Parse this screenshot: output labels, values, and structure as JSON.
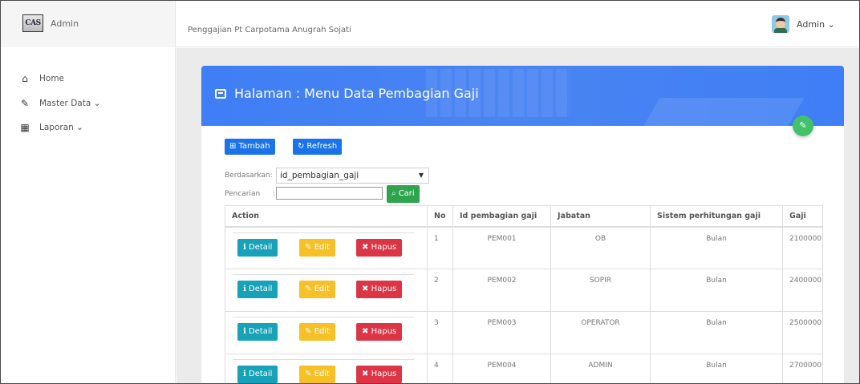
{
  "brand": {
    "logo_text": "CAS",
    "title": "Admin"
  },
  "header": {
    "app_title": "Penggajian Pt Carpotama Anugrah Sojati",
    "user_label": "Admin ⌄"
  },
  "sidebar": {
    "items": [
      {
        "label": "Home",
        "icon": "home-icon"
      },
      {
        "label": "Master Data ⌄",
        "icon": "edit-icon"
      },
      {
        "label": "Laporan ⌄",
        "icon": "calendar-icon"
      }
    ]
  },
  "page": {
    "title": "Halaman : Menu Data Pembagian Gaji",
    "add_label": "Tambah",
    "refresh_label": "Refresh",
    "filter_label": "Berdasarkan:",
    "filter_value": "id_pembagian_gaji",
    "search_label": "Pencarian",
    "search_sep": ":",
    "search_value": "",
    "search_button": "Cari"
  },
  "table": {
    "headers": [
      "Action",
      "No",
      "Id pembagian gaji",
      "Jabatan",
      "Sistem perhitungan gaji",
      "Gaji"
    ],
    "action_labels": {
      "detail": "Detail",
      "edit": "Edit",
      "delete": "Hapus"
    },
    "rows": [
      {
        "no": "1",
        "id": "PEM001",
        "jabatan": "OB",
        "sistem": "Bulan",
        "gaji": "2100000"
      },
      {
        "no": "2",
        "id": "PEM002",
        "jabatan": "SOPIR",
        "sistem": "Bulan",
        "gaji": "2400000"
      },
      {
        "no": "3",
        "id": "PEM003",
        "jabatan": "OPERATOR",
        "sistem": "Bulan",
        "gaji": "2500000"
      },
      {
        "no": "4",
        "id": "PEM004",
        "jabatan": "ADMIN",
        "sistem": "Bulan",
        "gaji": "2700000"
      }
    ]
  },
  "colors": {
    "primary": "#3f7ef5",
    "success": "#2ea44f",
    "info": "#17a2b8",
    "warning": "#f6c026",
    "danger": "#dc3545"
  }
}
